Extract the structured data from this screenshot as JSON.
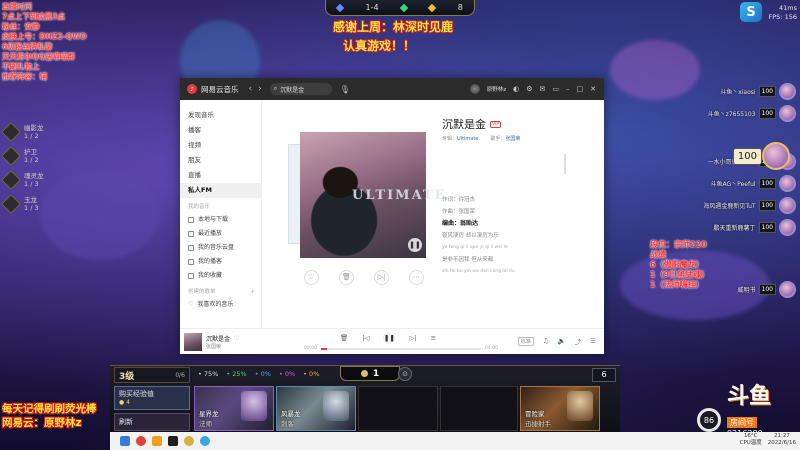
{
  "game": {
    "top_hud": {
      "round": "1-4",
      "stage": "8"
    },
    "danmaku": [
      "感谢上周：林深时见鹿",
      "认真游戏！！"
    ],
    "left_overlay": [
      "直播时间",
      "7点上下到凌晨3点",
      "粉丝：安静",
      "皮肤上号：DHZ2-QWD",
      "6级粉丝牌私聊",
      "天天尼尔QQ送喵喵群",
      "不刷礼物上",
      "推荐阵容：辅"
    ],
    "traits": [
      {
        "name": "幽影龙",
        "count": "1 / 2"
      },
      {
        "name": "护卫",
        "count": "1 / 2"
      },
      {
        "name": "魂灵龙",
        "count": "1 / 3"
      },
      {
        "name": "玉龙",
        "count": "1 / 3"
      }
    ],
    "opponents": [
      {
        "name": "斗鱼丶xiaosi",
        "hp": "100"
      },
      {
        "name": "斗鱼丶z7655103",
        "hp": "100"
      },
      {
        "name": "一水小哥就薯丁啊",
        "hp": "100"
      },
      {
        "name": "斗鱼AG丶Peeful",
        "hp": "100"
      },
      {
        "name": "海风遇金鹿新见TuT",
        "hp": "100"
      },
      {
        "name": "鹏天重新鹿薯丁",
        "hp": "100"
      },
      {
        "name": "威明书",
        "hp": "100"
      }
    ],
    "self_hp": "100",
    "right_overlay": [
      "段位：宗师220",
      "战绩",
      "6（傲影魔龙）",
      "1（9日黑猛魂）",
      "1（法师嗨挂）"
    ],
    "fps": {
      "ms": "41ms",
      "label": "FPS:",
      "value": "156"
    },
    "bottom_hud": {
      "level": "3级",
      "xp": "0/6",
      "odds": [
        "• 75%",
        "• 25%",
        "• 0%",
        "• 0%",
        "• 0%"
      ],
      "gold": "1",
      "right_count": "6",
      "buy_xp_label": "购买经验值",
      "buy_xp_cost": "● 4",
      "reroll_label": "刷新",
      "shop": [
        {
          "name": "星界龙",
          "trait": "法师",
          "filled": true,
          "style": "c1"
        },
        {
          "name": "风暴龙",
          "trait": "刺客",
          "filled": true,
          "style": "c2"
        },
        {
          "name": "",
          "trait": "",
          "filled": false,
          "style": ""
        },
        {
          "name": "",
          "trait": "",
          "filled": false,
          "style": ""
        },
        {
          "name": "冒险家",
          "trait": "迅捷射手",
          "filled": true,
          "style": "c5"
        }
      ]
    },
    "bottom_ad": [
      "每天记得刷刷荧光棒",
      "网易云：原野林z"
    ],
    "self_hp_ring": "86",
    "douyu": {
      "logo": "斗鱼",
      "room_label": "房间号",
      "room_id": "9216280"
    }
  },
  "taskbar": {
    "weather": [
      "16°C",
      "CPU温度"
    ],
    "clock": [
      "21:27",
      "2022/6/16"
    ]
  },
  "music": {
    "title": "网易云音乐",
    "search_value": "沉默是金",
    "user_tag": "原野林z",
    "sidebar": {
      "items": [
        "发现音乐",
        "播客",
        "视频",
        "朋友",
        "直播",
        "私人FM"
      ],
      "active_index": 5,
      "section_mine": "我的音乐",
      "mine": [
        "本地与下载",
        "最近播放",
        "我的音乐云盘",
        "我的播客",
        "我的收藏"
      ],
      "section_playlists": "创建的歌单",
      "playlists": [
        "我喜欢的音乐"
      ]
    },
    "album_text": "ULTIMATE",
    "song": {
      "title": "沉默是金",
      "badge": "VIP",
      "album_label": "专辑：",
      "album": "Ultimate",
      "artist_label": "歌手：",
      "artist": "张国荣"
    },
    "lyrics": [
      {
        "text": "作词：许冠杰",
        "cls": ""
      },
      {
        "text": "作曲：张国荣",
        "cls": ""
      },
      {
        "text": "编曲：翁贻达",
        "cls": "cur"
      },
      {
        "text": "夜风凄厉 却以凄厉为乐",
        "cls": ""
      },
      {
        "text": "ye feng qi li que yi qi li wei le",
        "cls": "sm"
      },
      {
        "text": "是非不因我 但从来都",
        "cls": ""
      },
      {
        "text": "shi fei bu yin wo dan cong lai du",
        "cls": "sm"
      }
    ],
    "player": {
      "title": "沉默是金",
      "artist": "张国荣",
      "time_current": "00:00",
      "time_total": "04:00",
      "progress": 0.04,
      "quality": "标准"
    }
  }
}
